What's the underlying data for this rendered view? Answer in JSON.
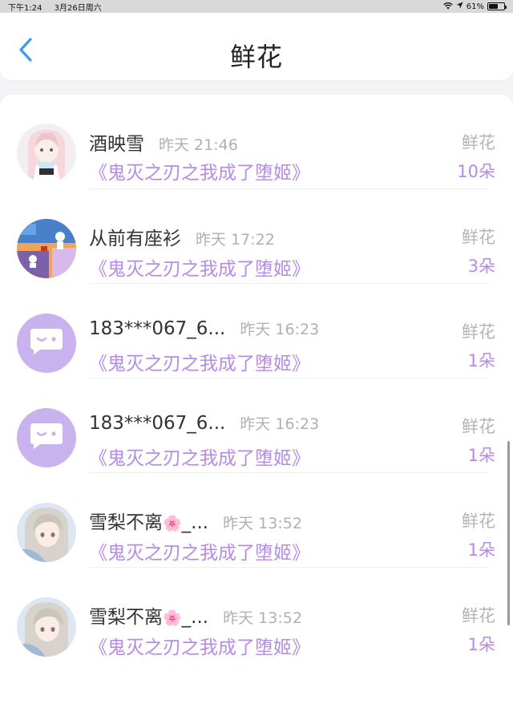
{
  "status_bar": {
    "time": "下午1:24",
    "date": "3月26日周六",
    "battery": "61%",
    "battery_level": 0.61
  },
  "header": {
    "title": "鲜花",
    "back_icon": "chevron-left-icon"
  },
  "colors": {
    "accent_purple": "#b68be6",
    "back_blue": "#3a9bf0"
  },
  "rows": [
    {
      "name": "酒映雪",
      "time": "昨天 21:46",
      "book": "《鬼灭之刃之我成了堕姬》",
      "gift_label": "鲜花",
      "count": "10朵",
      "avatar": "anime-girl-avatar"
    },
    {
      "name": "从前有座衫",
      "time": "昨天 17:22",
      "book": "《鬼灭之刃之我成了堕姬》",
      "gift_label": "鲜花",
      "count": "3朵",
      "avatar": "game-scene-avatar"
    },
    {
      "name": "183***067_6...",
      "time": "昨天 16:23",
      "book": "《鬼灭之刃之我成了堕姬》",
      "gift_label": "鲜花",
      "count": "1朵",
      "avatar": "default-chat-avatar"
    },
    {
      "name": "183***067_6...",
      "time": "昨天 16:23",
      "book": "《鬼灭之刃之我成了堕姬》",
      "gift_label": "鲜花",
      "count": "1朵",
      "avatar": "default-chat-avatar"
    },
    {
      "name": "雪梨不离",
      "name_suffix": "_...",
      "time": "昨天 13:52",
      "book": "《鬼灭之刃之我成了堕姬》",
      "gift_label": "鲜花",
      "count": "1朵",
      "avatar": "anime-silver-hair-avatar"
    },
    {
      "name": "雪梨不离",
      "name_suffix": "_...",
      "time": "昨天 13:52",
      "book": "《鬼灭之刃之我成了堕姬》",
      "gift_label": "鲜花",
      "count": "1朵",
      "avatar": "anime-silver-hair-avatar"
    }
  ]
}
